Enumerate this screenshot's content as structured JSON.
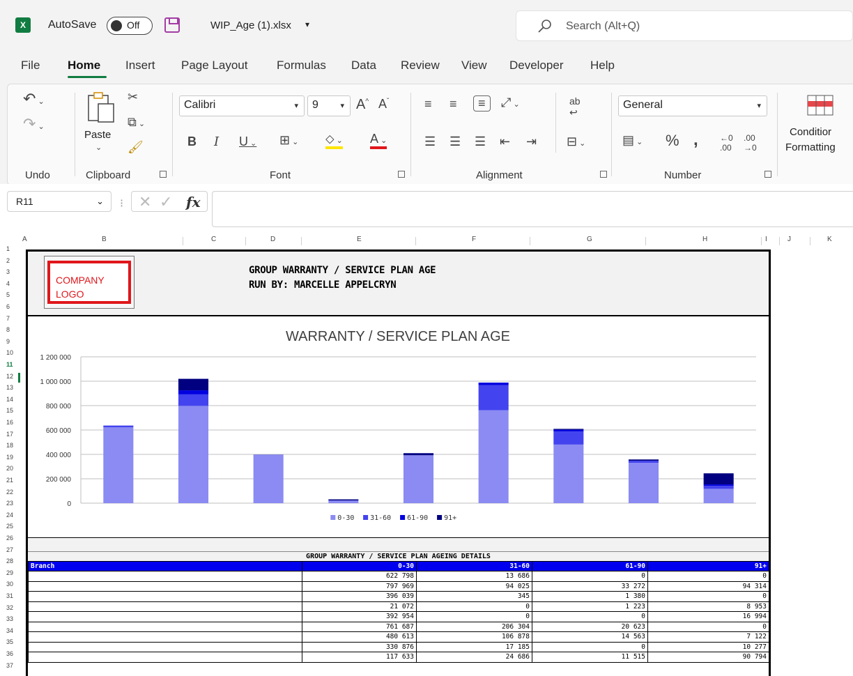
{
  "titlebar": {
    "app_badge": "X",
    "autosave_label": "AutoSave",
    "autosave_state": "Off",
    "file_name": "WIP_Age (1).xlsx",
    "search_placeholder": "Search (Alt+Q)"
  },
  "tabs": [
    "File",
    "Home",
    "Insert",
    "Page Layout",
    "Formulas",
    "Data",
    "Review",
    "View",
    "Developer",
    "Help"
  ],
  "active_tab": "Home",
  "ribbon": {
    "groups": [
      "Undo",
      "Clipboard",
      "Font",
      "Alignment",
      "Number"
    ],
    "paste_label": "Paste",
    "font_name": "Calibri",
    "font_size": "9",
    "number_format": "General",
    "conditional_formatting_line1": "Conditior",
    "conditional_formatting_line2": "Formatting"
  },
  "formula_bar": {
    "name_box": "R11",
    "fx": "fx",
    "formula": ""
  },
  "sheet": {
    "columns": [
      "A",
      "B",
      "C",
      "D",
      "E",
      "F",
      "G",
      "H",
      "I",
      "J",
      "K"
    ],
    "rows": [
      "1",
      "2",
      "3",
      "4",
      "5",
      "6",
      "7",
      "8",
      "9",
      "10",
      "11",
      "12",
      "13",
      "14",
      "15",
      "16",
      "17",
      "18",
      "19",
      "20",
      "21",
      "22",
      "23",
      "24",
      "25",
      "26",
      "27",
      "28",
      "29",
      "30",
      "31",
      "32",
      "33",
      "34",
      "35",
      "36",
      "37"
    ],
    "selected_row": "11"
  },
  "report": {
    "logo_line1": "COMPANY",
    "logo_line2": "LOGO",
    "header_line1": "GROUP WARRANTY / SERVICE PLAN AGE",
    "header_line2": "RUN BY: MARCELLE APPELCRYN",
    "table_title": "GROUP WARRANTY / SERVICE PLAN AGEING DETAILS",
    "table_headers": [
      "Branch",
      "0-30",
      "31-60",
      "61-90",
      "91+"
    ],
    "table_rows": [
      [
        "",
        "622 798",
        "13 686",
        "0",
        "0"
      ],
      [
        "",
        "797 969",
        "94 025",
        "33 272",
        "94 314"
      ],
      [
        "",
        "396 039",
        "345",
        "1 380",
        "0"
      ],
      [
        "",
        "21 072",
        "0",
        "1 223",
        "8 953"
      ],
      [
        "",
        "392 954",
        "0",
        "0",
        "16 994"
      ],
      [
        "",
        "761 687",
        "206 304",
        "20 623",
        "0"
      ],
      [
        "",
        "480 613",
        "106 878",
        "14 563",
        "7 122"
      ],
      [
        "",
        "330 876",
        "17 185",
        "0",
        "10 277"
      ],
      [
        "",
        "117 633",
        "24 686",
        "11 515",
        "90 794"
      ]
    ]
  },
  "chart_data": {
    "type": "bar",
    "stacked": true,
    "title": "WARRANTY / SERVICE PLAN AGE",
    "categories": [
      "",
      "",
      "",
      "",
      "",
      "",
      "",
      "",
      ""
    ],
    "series": [
      {
        "name": "0-30",
        "color": "#8b8bf3",
        "values": [
          622798,
          797969,
          396039,
          21072,
          392954,
          761687,
          480613,
          330876,
          117633
        ]
      },
      {
        "name": "31-60",
        "color": "#4343ef",
        "values": [
          13686,
          94025,
          345,
          0,
          0,
          206304,
          106878,
          17185,
          24686
        ]
      },
      {
        "name": "61-90",
        "color": "#0000e0",
        "values": [
          0,
          33272,
          1380,
          1223,
          0,
          20623,
          14563,
          0,
          11515
        ]
      },
      {
        "name": "91+",
        "color": "#000080",
        "values": [
          0,
          94314,
          0,
          8953,
          16994,
          0,
          7122,
          10277,
          90794
        ]
      }
    ],
    "ylim": [
      0,
      1200000
    ],
    "yticks": [
      "0",
      "200 000",
      "400 000",
      "600 000",
      "800 000",
      "1 000 000",
      "1 200 000"
    ],
    "grid": true,
    "legend_position": "bottom"
  }
}
